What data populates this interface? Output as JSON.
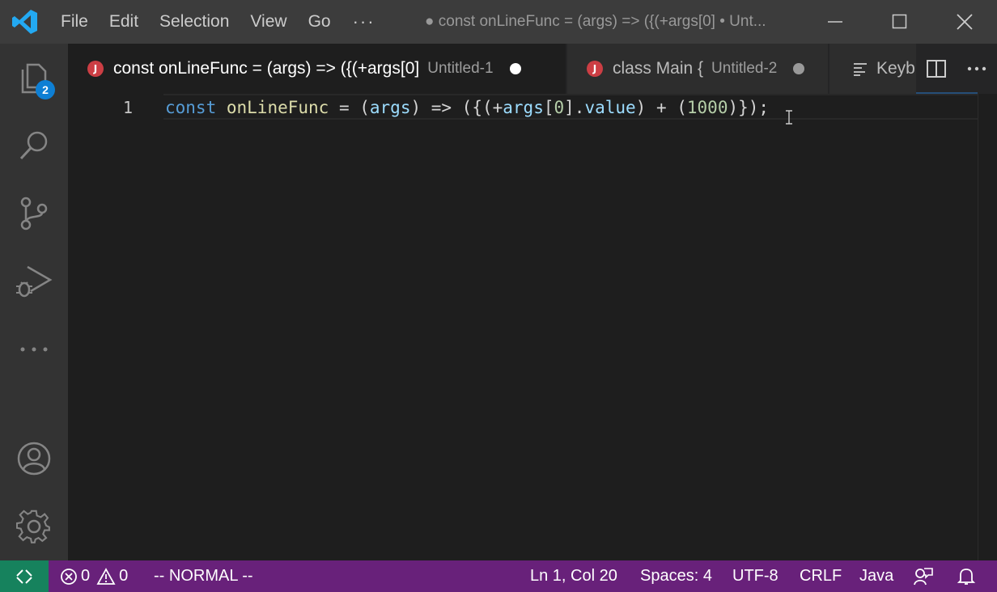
{
  "menu": {
    "items": [
      "File",
      "Edit",
      "Selection",
      "View",
      "Go"
    ],
    "more": "···"
  },
  "window": {
    "title": "● const onLineFunc = (args) => ({(+args[0] • Unt..."
  },
  "activity_bar": {
    "explorer_badge": "2"
  },
  "tabs": [
    {
      "icon": "J",
      "name": "const onLineFunc = (args) => ({(+args[0]",
      "description": "Untitled-1",
      "dirty": true,
      "active": true
    },
    {
      "icon": "J",
      "name": "class Main {",
      "description": "Untitled-2",
      "dirty": true,
      "active": false
    },
    {
      "name": "Keyb"
    }
  ],
  "editor": {
    "line_number": "1",
    "code_tokens": [
      {
        "text": "const",
        "kind": "kw"
      },
      {
        "text": " ",
        "kind": "plain"
      },
      {
        "text": "onLineFunc",
        "kind": "fn"
      },
      {
        "text": " = (",
        "kind": "plain"
      },
      {
        "text": "args",
        "kind": "prop"
      },
      {
        "text": ") => ({(+",
        "kind": "plain"
      },
      {
        "text": "args",
        "kind": "prop"
      },
      {
        "text": "[",
        "kind": "plain"
      },
      {
        "text": "0",
        "kind": "num"
      },
      {
        "text": "].",
        "kind": "plain"
      },
      {
        "text": "value",
        "kind": "prop"
      },
      {
        "text": ") + (",
        "kind": "plain"
      },
      {
        "text": "1000",
        "kind": "num"
      },
      {
        "text": ")});",
        "kind": "plain"
      }
    ]
  },
  "status_bar": {
    "errors": "0",
    "warnings": "0",
    "vim_mode": "-- NORMAL --",
    "cursor_position": "Ln 1, Col 20",
    "indentation": "Spaces: 4",
    "encoding": "UTF-8",
    "line_ending": "CRLF",
    "language": "Java"
  },
  "colors": {
    "statusbar": "#68217a",
    "remote": "#16825d",
    "badge": "#0e7fd4",
    "java_icon": "#cc3e44"
  }
}
